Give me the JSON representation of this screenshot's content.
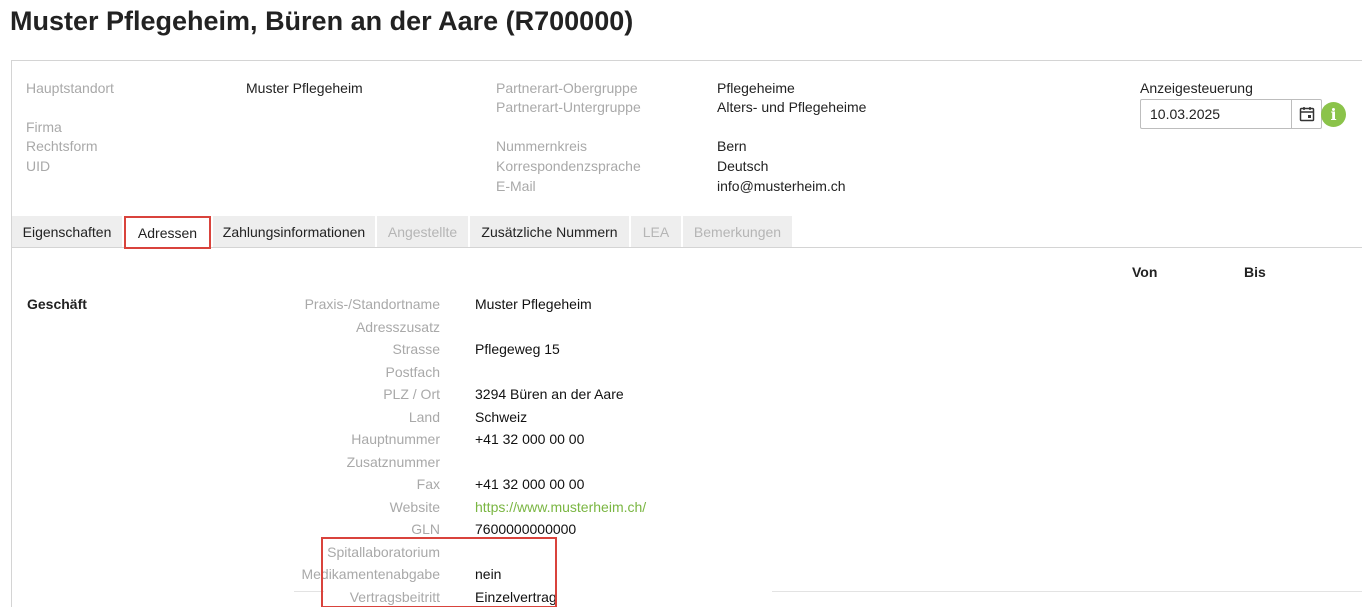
{
  "page": {
    "title": "Muster Pflegeheim, Büren an der Aare (R700000)"
  },
  "header_info": {
    "hauptstandort_label": "Hauptstandort",
    "hauptstandort_value": "Muster Pflegeheim",
    "firma_label": "Firma",
    "rechtsform_label": "Rechtsform",
    "uid_label": "UID",
    "obergruppe_label": "Partnerart-Obergruppe",
    "obergruppe_value": "Pflegeheime",
    "untergruppe_label": "Partnerart-Untergruppe",
    "untergruppe_value": "Alters- und Pflegeheime",
    "nummernkreis_label": "Nummernkreis",
    "nummernkreis_value": "Bern",
    "korrespondenz_label": "Korrespondenzsprache",
    "korrespondenz_value": "Deutsch",
    "email_label": "E-Mail",
    "email_value": "info@musterheim.ch",
    "anzeige_label": "Anzeigesteuerung",
    "anzeige_date": "10.03.2025"
  },
  "tabs": [
    {
      "label": "Eigenschaften",
      "state": "normal"
    },
    {
      "label": "Adressen",
      "state": "active"
    },
    {
      "label": "Zahlungsinformationen",
      "state": "normal"
    },
    {
      "label": "Angestellte",
      "state": "disabled"
    },
    {
      "label": "Zusätzliche Nummern",
      "state": "normal"
    },
    {
      "label": "LEA",
      "state": "disabled"
    },
    {
      "label": "Bemerkungen",
      "state": "disabled"
    }
  ],
  "columns": {
    "von": "Von",
    "bis": "Bis"
  },
  "section": {
    "title": "Geschäft",
    "rows": [
      {
        "label": "Praxis-/Standortname",
        "value": "Muster Pflegeheim"
      },
      {
        "label": "Adresszusatz",
        "value": ""
      },
      {
        "label": "Strasse",
        "value": "Pflegeweg 15"
      },
      {
        "label": "Postfach",
        "value": ""
      },
      {
        "label": "PLZ / Ort",
        "value": "3294 Büren an der Aare"
      },
      {
        "label": "Land",
        "value": "Schweiz"
      },
      {
        "label": "Hauptnummer",
        "value": "+41 32 000 00 00"
      },
      {
        "label": "Zusatznummer",
        "value": ""
      },
      {
        "label": "Fax",
        "value": "+41 32 000 00 00"
      },
      {
        "label": "Website",
        "value": "https://www.musterheim.ch/"
      },
      {
        "label": "GLN",
        "value": "7600000000000"
      },
      {
        "label": "Spitallaboratorium",
        "value": ""
      },
      {
        "label": "Medikamentenabgabe",
        "value": "nein"
      },
      {
        "label": "Vertragsbeitritt",
        "value": "Einzelvertrag"
      }
    ]
  },
  "colors": {
    "accent_green": "#8bc34a",
    "link_green": "#7ab642",
    "highlight_red": "#d9433c",
    "label_grey": "#a9a9a9"
  },
  "icons": {
    "calendar": "calendar-icon",
    "info": "info-icon"
  }
}
